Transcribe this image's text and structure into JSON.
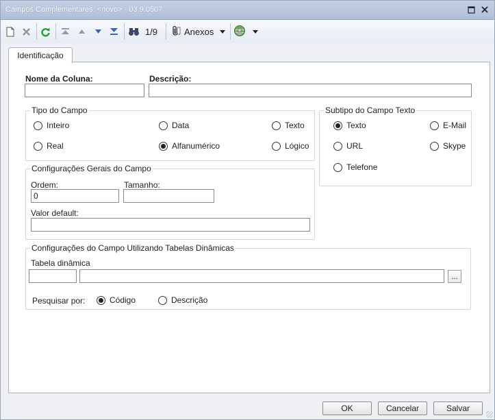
{
  "window": {
    "title": "Campos Complementares: <novo> - 03.9.0507",
    "restore_icon": "restore-icon",
    "close_icon": "close-icon"
  },
  "toolbar": {
    "record_counter": "1/9",
    "attachments_label": "Anexos",
    "icons": [
      "new-document-icon",
      "delete-icon",
      "refresh-icon",
      "first-record-icon",
      "previous-record-icon",
      "next-record-icon",
      "last-record-icon",
      "binoculars-icon",
      "paperclip-icon",
      "globe-user-icon"
    ]
  },
  "tabs": [
    {
      "label": "Identificação",
      "active": true
    }
  ],
  "form": {
    "column_name_label": "Nome da Coluna:",
    "column_name_value": "",
    "description_label": "Descrição:",
    "description_value": "",
    "field_type": {
      "title": "Tipo do Campo",
      "options": [
        {
          "label": "Inteiro",
          "selected": false
        },
        {
          "label": "Data",
          "selected": false
        },
        {
          "label": "Texto",
          "selected": false
        },
        {
          "label": "Real",
          "selected": false
        },
        {
          "label": "Alfanumérico",
          "selected": true
        },
        {
          "label": "Lógico",
          "selected": false
        }
      ]
    },
    "text_subtype": {
      "title": "Subtipo do Campo Texto",
      "options": [
        {
          "label": "Texto",
          "selected": true
        },
        {
          "label": "E-Mail",
          "selected": false
        },
        {
          "label": "URL",
          "selected": false
        },
        {
          "label": "Skype",
          "selected": false
        },
        {
          "label": "Telefone",
          "selected": false
        }
      ]
    },
    "general_config": {
      "title": "Configurações Gerais do Campo",
      "order_label": "Ordem:",
      "order_value": "0",
      "size_label": "Tamanho:",
      "size_value": "",
      "default_label": "Valor default:",
      "default_value": ""
    },
    "dynamic_tables": {
      "title": "Configurações do Campo Utilizando Tabelas Dinâmicas",
      "table_label": "Tabela dinâmica",
      "table_code_value": "",
      "table_desc_value": "",
      "browse_label": "...",
      "search_by_label": "Pesquisar por:",
      "search_options": [
        {
          "label": "Código",
          "selected": true
        },
        {
          "label": "Descrição",
          "selected": false
        }
      ]
    }
  },
  "footer": {
    "ok_label": "OK",
    "cancel_label": "Cancelar",
    "save_label": "Salvar"
  }
}
